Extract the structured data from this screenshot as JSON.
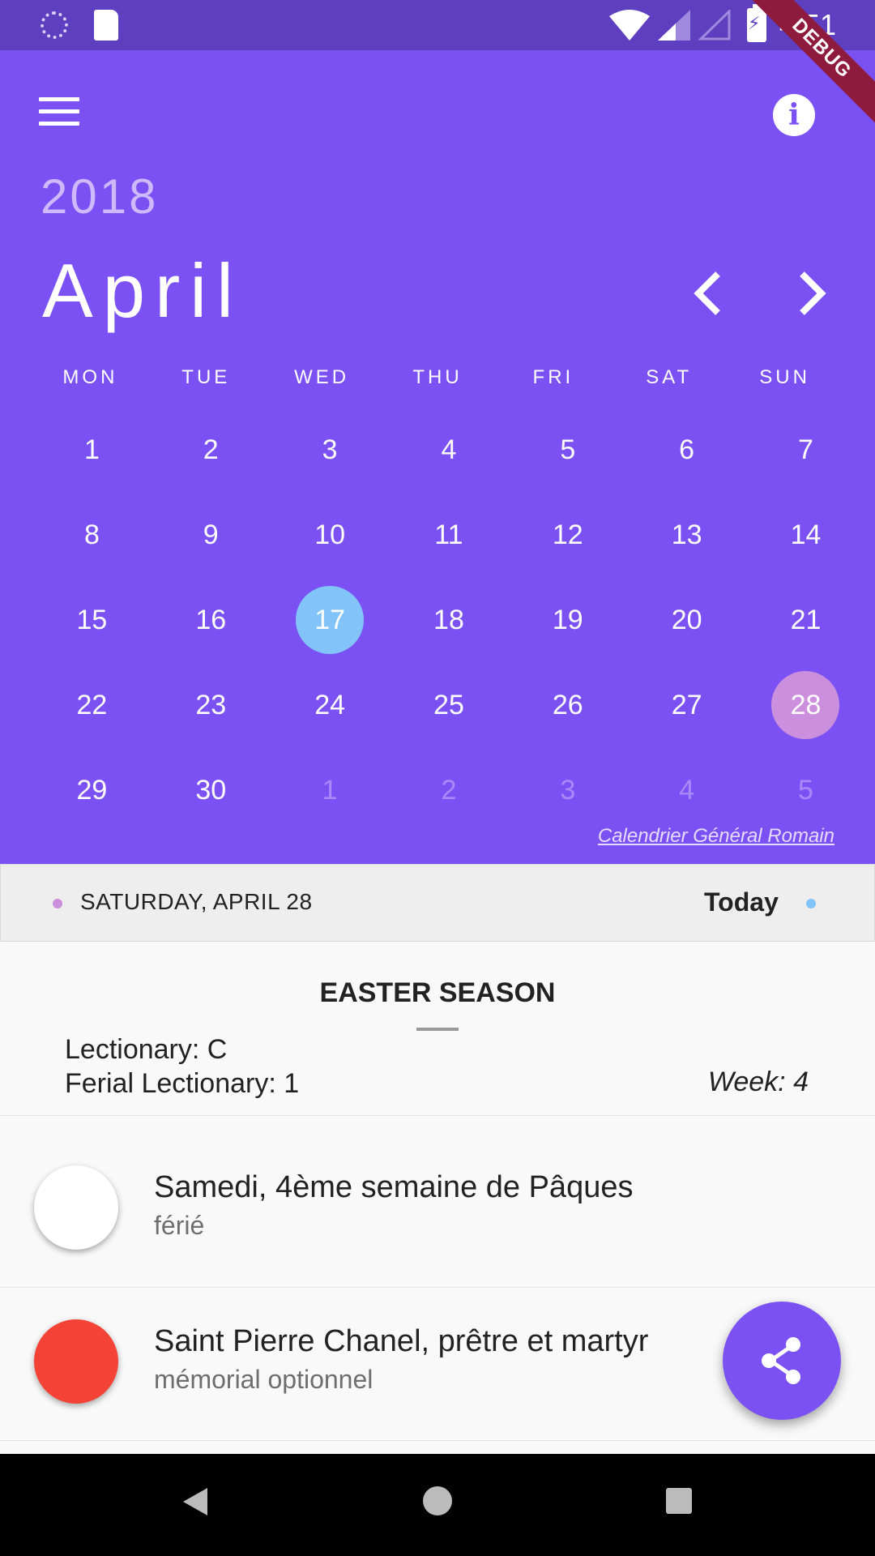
{
  "status_bar": {
    "time": "4:51",
    "icons": [
      "loading-icon",
      "sd-card-icon",
      "wifi-icon",
      "signal-icon",
      "signal-empty-icon",
      "battery-charging-icon"
    ]
  },
  "debug_banner": "DEBUG",
  "header": {
    "year": "2018",
    "month": "April",
    "icons": [
      "menu-icon",
      "info-icon",
      "chevron-left-icon",
      "chevron-right-icon"
    ],
    "weekdays": [
      "MON",
      "TUE",
      "WED",
      "THU",
      "FRI",
      "SAT",
      "SUN"
    ],
    "days": [
      {
        "label": "1",
        "in_month": true
      },
      {
        "label": "2",
        "in_month": true
      },
      {
        "label": "3",
        "in_month": true
      },
      {
        "label": "4",
        "in_month": true
      },
      {
        "label": "5",
        "in_month": true
      },
      {
        "label": "6",
        "in_month": true
      },
      {
        "label": "7",
        "in_month": true
      },
      {
        "label": "8",
        "in_month": true
      },
      {
        "label": "9",
        "in_month": true
      },
      {
        "label": "10",
        "in_month": true
      },
      {
        "label": "11",
        "in_month": true
      },
      {
        "label": "12",
        "in_month": true
      },
      {
        "label": "13",
        "in_month": true
      },
      {
        "label": "14",
        "in_month": true
      },
      {
        "label": "15",
        "in_month": true
      },
      {
        "label": "16",
        "in_month": true
      },
      {
        "label": "17",
        "in_month": true,
        "state": "selected"
      },
      {
        "label": "18",
        "in_month": true
      },
      {
        "label": "19",
        "in_month": true
      },
      {
        "label": "20",
        "in_month": true
      },
      {
        "label": "21",
        "in_month": true
      },
      {
        "label": "22",
        "in_month": true
      },
      {
        "label": "23",
        "in_month": true
      },
      {
        "label": "24",
        "in_month": true
      },
      {
        "label": "25",
        "in_month": true
      },
      {
        "label": "26",
        "in_month": true
      },
      {
        "label": "27",
        "in_month": true
      },
      {
        "label": "28",
        "in_month": true,
        "state": "today"
      },
      {
        "label": "29",
        "in_month": true
      },
      {
        "label": "30",
        "in_month": true
      },
      {
        "label": "1",
        "in_month": false
      },
      {
        "label": "2",
        "in_month": false
      },
      {
        "label": "3",
        "in_month": false
      },
      {
        "label": "4",
        "in_month": false
      },
      {
        "label": "5",
        "in_month": false
      }
    ],
    "source_link": "Calendrier Général Romain"
  },
  "date_bar": {
    "date": "SATURDAY, APRIL 28",
    "today_label": "Today"
  },
  "season": {
    "title": "EASTER SEASON",
    "lectionary": "Lectionary: C",
    "ferial_lectionary": "Ferial Lectionary: 1",
    "week": "Week: 4"
  },
  "celebrations": [
    {
      "title": "Samedi, 4ème semaine de Pâques",
      "rank": "férié",
      "color": "#ffffff"
    },
    {
      "title": "Saint Pierre Chanel, prêtre et martyr",
      "rank": "mémorial optionnel",
      "color": "#f44336"
    }
  ],
  "fab": {
    "icon": "share-icon"
  },
  "nav_bar": {
    "icons": [
      "back-icon",
      "home-icon",
      "recents-icon"
    ]
  },
  "colors": {
    "primary": "#7c51f4",
    "status_bar": "#5e3fbf",
    "selected_day": "#82c3f9",
    "today_day": "#cc8fdd"
  }
}
